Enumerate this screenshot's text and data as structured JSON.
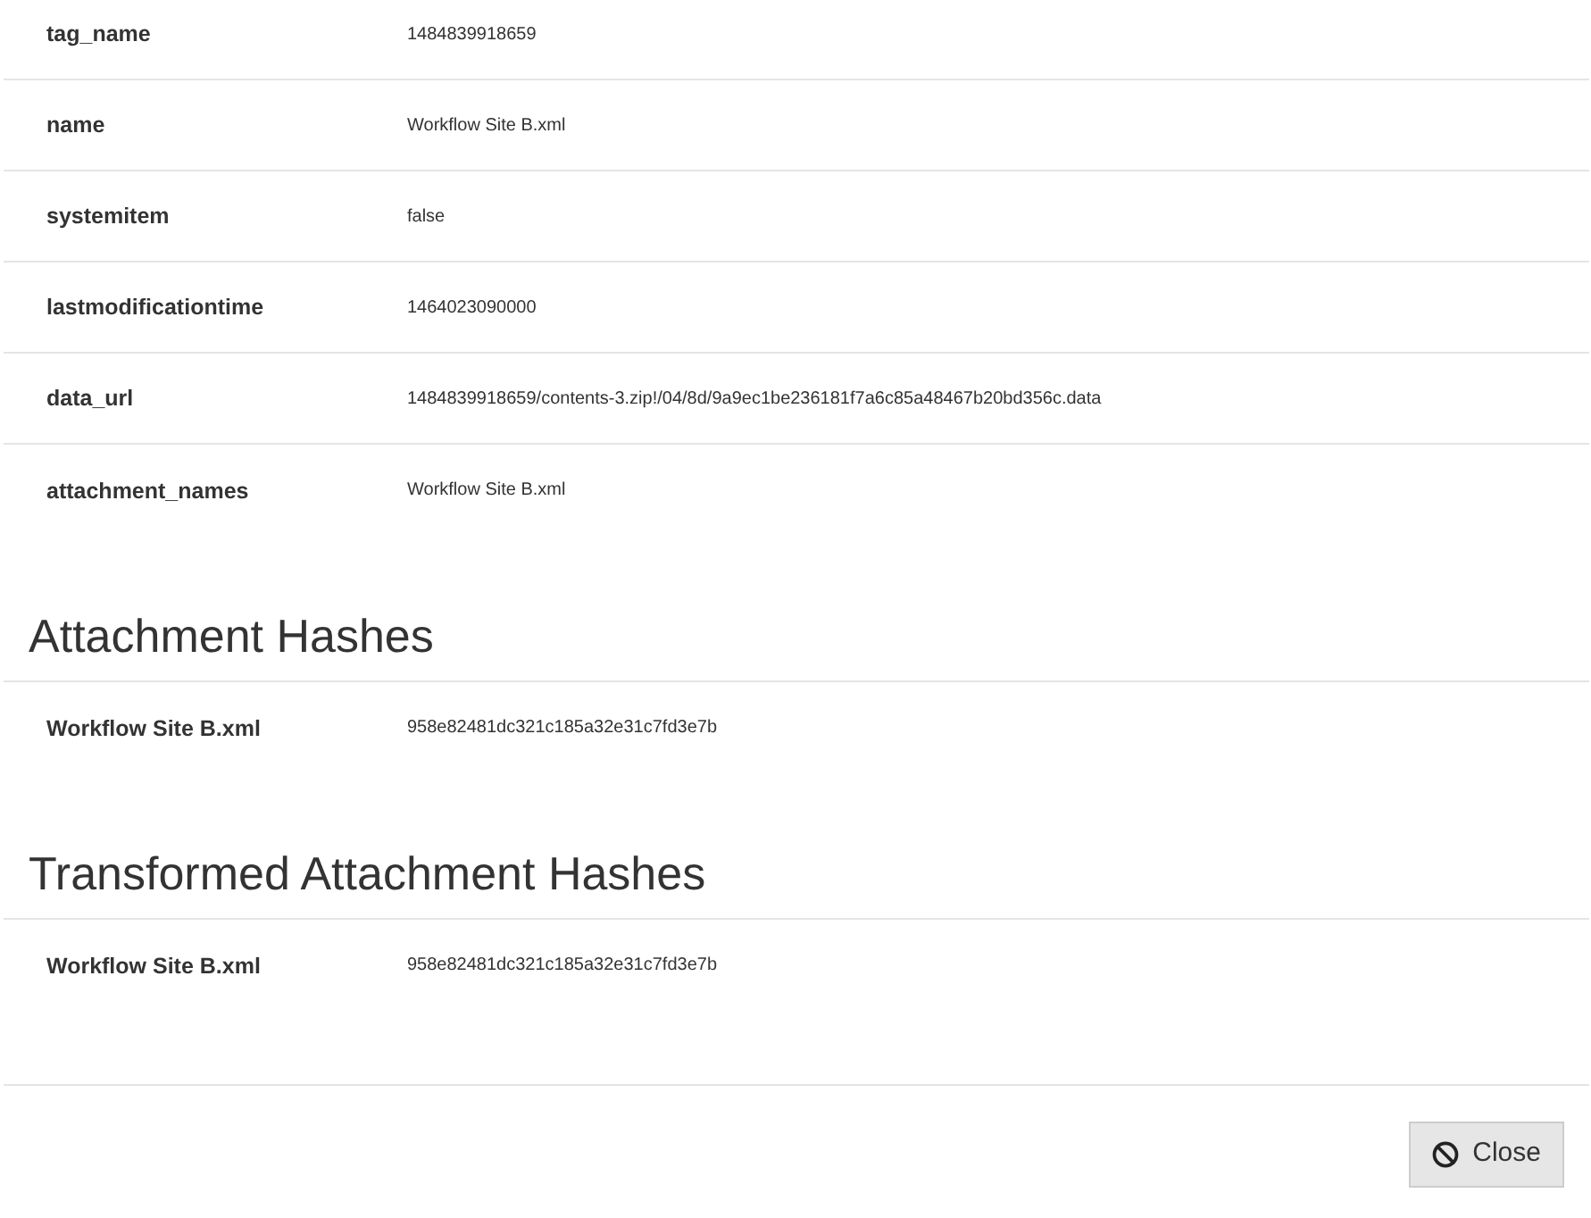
{
  "properties": [
    {
      "key": "tag_name",
      "value": "1484839918659"
    },
    {
      "key": "name",
      "value": "Workflow Site B.xml"
    },
    {
      "key": "systemitem",
      "value": "false"
    },
    {
      "key": "lastmodificationtime",
      "value": "1464023090000"
    },
    {
      "key": "data_url",
      "value": "1484839918659/contents-3.zip!/04/8d/9a9ec1be236181f7a6c85a48467b20bd356c.data"
    },
    {
      "key": "attachment_names",
      "value": "Workflow Site B.xml"
    }
  ],
  "sections": [
    {
      "title": "Attachment Hashes",
      "rows": [
        {
          "key": "Workflow Site B.xml",
          "value": "958e82481dc321c185a32e31c7fd3e7b"
        }
      ]
    },
    {
      "title": "Transformed Attachment Hashes",
      "rows": [
        {
          "key": "Workflow Site B.xml",
          "value": "958e82481dc321c185a32e31c7fd3e7b"
        }
      ]
    }
  ],
  "footer": {
    "buttons": [
      {
        "label": "Close",
        "kind": "close"
      }
    ]
  }
}
